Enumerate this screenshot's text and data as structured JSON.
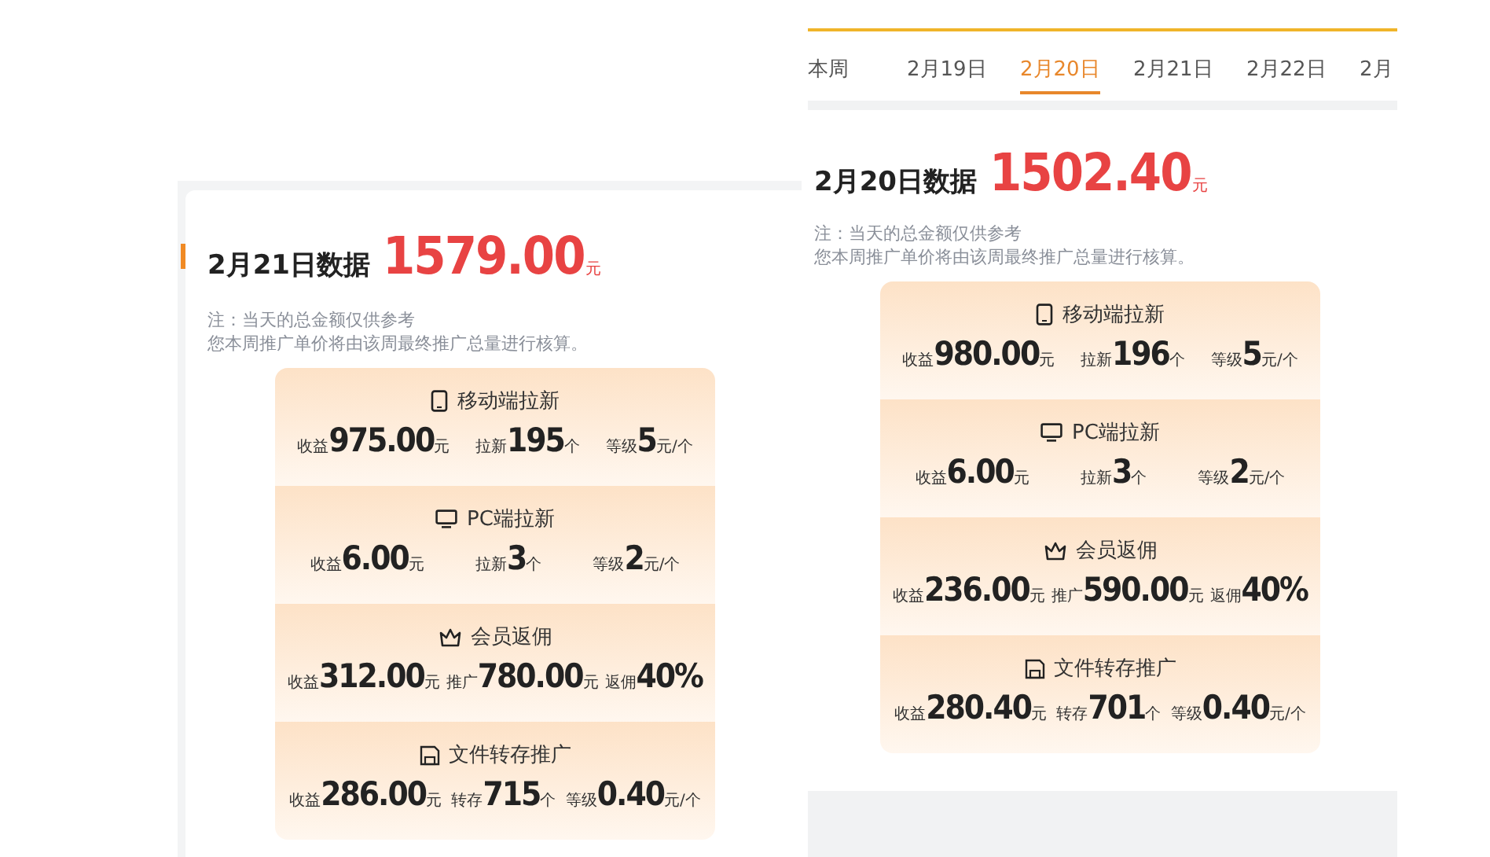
{
  "tabs": [
    {
      "label": "本周",
      "selected": false
    },
    {
      "label": "2月19日",
      "selected": false
    },
    {
      "label": "2月20日",
      "selected": true
    },
    {
      "label": "2月21日",
      "selected": false
    },
    {
      "label": "2月22日",
      "selected": false
    },
    {
      "label": "2月",
      "selected": false
    }
  ],
  "panels": [
    {
      "title": "2月21日数据",
      "amount": "1579.00",
      "unit": "元",
      "notes": [
        "注：当天的总金额仅供参考",
        "您本周推广单价将由该周最终推广总量进行核算。"
      ],
      "sections": [
        {
          "kind": "mobile",
          "title": "移动端拉新",
          "stats": [
            {
              "label": "收益",
              "value": "975.00",
              "unit": "元"
            },
            {
              "label": "拉新",
              "value": "195",
              "unit": "个"
            },
            {
              "label": "等级",
              "value": "5",
              "unit": "元/个"
            }
          ]
        },
        {
          "kind": "pc",
          "title": "PC端拉新",
          "stats": [
            {
              "label": "收益",
              "value": "6.00",
              "unit": "元"
            },
            {
              "label": "拉新",
              "value": "3",
              "unit": "个"
            },
            {
              "label": "等级",
              "value": "2",
              "unit": "元/个"
            }
          ]
        },
        {
          "kind": "member",
          "title": "会员返佣",
          "stats": [
            {
              "label": "收益",
              "value": "312.00",
              "unit": "元"
            },
            {
              "label": "推广",
              "value": "780.00",
              "unit": "元"
            },
            {
              "label": "返佣",
              "value": "40%"
            }
          ]
        },
        {
          "kind": "file",
          "title": "文件转存推广",
          "stats": [
            {
              "label": "收益",
              "value": "286.00",
              "unit": "元"
            },
            {
              "label": "转存",
              "value": "715",
              "unit": "个"
            },
            {
              "label": "等级",
              "value": "0.40",
              "unit": "元/个"
            }
          ]
        }
      ]
    },
    {
      "title": "2月20日数据",
      "amount": "1502.40",
      "unit": "元",
      "notes": [
        "注：当天的总金额仅供参考",
        "您本周推广单价将由该周最终推广总量进行核算。"
      ],
      "sections": [
        {
          "kind": "mobile",
          "title": "移动端拉新",
          "stats": [
            {
              "label": "收益",
              "value": "980.00",
              "unit": "元"
            },
            {
              "label": "拉新",
              "value": "196",
              "unit": "个"
            },
            {
              "label": "等级",
              "value": "5",
              "unit": "元/个"
            }
          ]
        },
        {
          "kind": "pc",
          "title": "PC端拉新",
          "stats": [
            {
              "label": "收益",
              "value": "6.00",
              "unit": "元"
            },
            {
              "label": "拉新",
              "value": "3",
              "unit": "个"
            },
            {
              "label": "等级",
              "value": "2",
              "unit": "元/个"
            }
          ]
        },
        {
          "kind": "member",
          "title": "会员返佣",
          "stats": [
            {
              "label": "收益",
              "value": "236.00",
              "unit": "元"
            },
            {
              "label": "推广",
              "value": "590.00",
              "unit": "元"
            },
            {
              "label": "返佣",
              "value": "40%"
            }
          ]
        },
        {
          "kind": "file",
          "title": "文件转存推广",
          "stats": [
            {
              "label": "收益",
              "value": "280.40",
              "unit": "元"
            },
            {
              "label": "转存",
              "value": "701",
              "unit": "个"
            },
            {
              "label": "等级",
              "value": "0.40",
              "unit": "元/个"
            }
          ]
        }
      ]
    }
  ]
}
